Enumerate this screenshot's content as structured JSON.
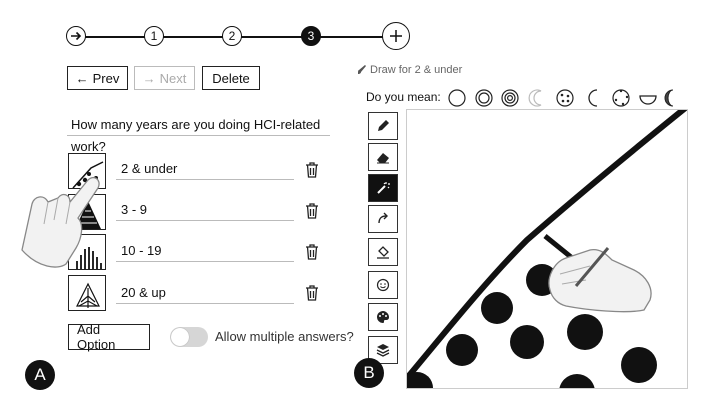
{
  "stepper": {
    "steps": [
      "1",
      "2",
      "3"
    ],
    "active_index": 2
  },
  "nav": {
    "prev_label": "Prev",
    "next_label": "Next",
    "delete_label": "Delete"
  },
  "question": {
    "text": "How many years are you doing HCI-related work?"
  },
  "options": [
    {
      "label": "2 & under"
    },
    {
      "label": "3 - 9"
    },
    {
      "label": "10 - 19"
    },
    {
      "label": "20 & up"
    }
  ],
  "add_option_label": "Add Option",
  "multi_answers": {
    "label": "Allow multiple answers?",
    "enabled": false
  },
  "panel_labels": {
    "left": "A",
    "right": "B"
  },
  "draw": {
    "title": "Draw for 2 & under",
    "suggest_label": "Do you mean:",
    "tools": [
      "pencil-icon",
      "eraser-icon",
      "magic-wand-icon",
      "redo-icon",
      "fill-bucket-icon",
      "smiley-icon",
      "palette-icon",
      "layers-icon"
    ],
    "active_tool": "magic-wand-icon"
  },
  "colors": {
    "ink": "#111111",
    "disabled": "#aaaaaa",
    "toggle_off": "#d6d6d6"
  }
}
